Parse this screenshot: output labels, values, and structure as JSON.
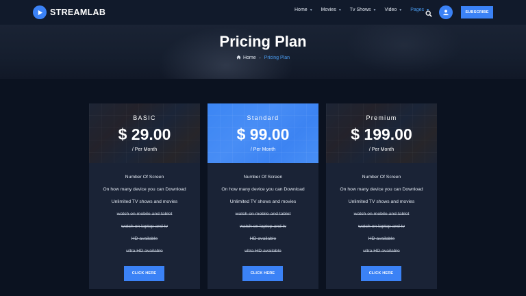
{
  "brand": {
    "name": "STREAMLAB",
    "logo_icon": "play-icon"
  },
  "nav": {
    "items": [
      {
        "label": "Home",
        "active": false
      },
      {
        "label": "Movies",
        "active": false
      },
      {
        "label": "Tv Shows",
        "active": false
      },
      {
        "label": "Video",
        "active": false
      },
      {
        "label": "Pages",
        "active": true
      }
    ],
    "search_icon": "search-icon",
    "avatar_icon": "user-icon",
    "subscribe_label": "SUBSCRIBE"
  },
  "hero": {
    "title": "Pricing Plan",
    "breadcrumb": {
      "home": "Home",
      "separator": "›",
      "current": "Pricing Plan"
    }
  },
  "plans": [
    {
      "name": "BASIC",
      "price": "$ 29.00",
      "period": "/ Per Month",
      "highlighted": false,
      "features": [
        {
          "text": "Number Of Screen",
          "included": true
        },
        {
          "text": "On how many device you can Download",
          "included": true
        },
        {
          "text": "Unlimited TV shows and movies",
          "included": true
        },
        {
          "text": "watch on mobile and tablet",
          "included": false
        },
        {
          "text": "watch on laptop and tv",
          "included": false
        },
        {
          "text": "HD available",
          "included": false
        },
        {
          "text": "ultra HD available",
          "included": false
        }
      ],
      "button": "CLICK HERE"
    },
    {
      "name": "Standard",
      "price": "$ 99.00",
      "period": "/ Per Month",
      "highlighted": true,
      "features": [
        {
          "text": "Number Of Screen",
          "included": true
        },
        {
          "text": "On how many device you can Download",
          "included": true
        },
        {
          "text": "Unlimited TV shows and movies",
          "included": true
        },
        {
          "text": "watch on mobile and tablet",
          "included": false
        },
        {
          "text": "watch on laptop and tv",
          "included": false
        },
        {
          "text": "HD available",
          "included": false
        },
        {
          "text": "ultra HD available",
          "included": false
        }
      ],
      "button": "CLICK HERE"
    },
    {
      "name": "Premium",
      "price": "$ 199.00",
      "period": "/ Per Month",
      "highlighted": false,
      "features": [
        {
          "text": "Number Of Screen",
          "included": true
        },
        {
          "text": "On how many device you can Download",
          "included": true
        },
        {
          "text": "Unlimited TV shows and movies",
          "included": true
        },
        {
          "text": "watch on mobile and tablet",
          "included": false
        },
        {
          "text": "watch on laptop and tv",
          "included": false
        },
        {
          "text": "HD available",
          "included": false
        },
        {
          "text": "ultra HD available",
          "included": false
        }
      ],
      "button": "CLICK HERE"
    }
  ],
  "colors": {
    "accent": "#3b82f6",
    "background": "#0b1220",
    "card": "#1a2336",
    "nav_active": "#4a9cf0"
  }
}
